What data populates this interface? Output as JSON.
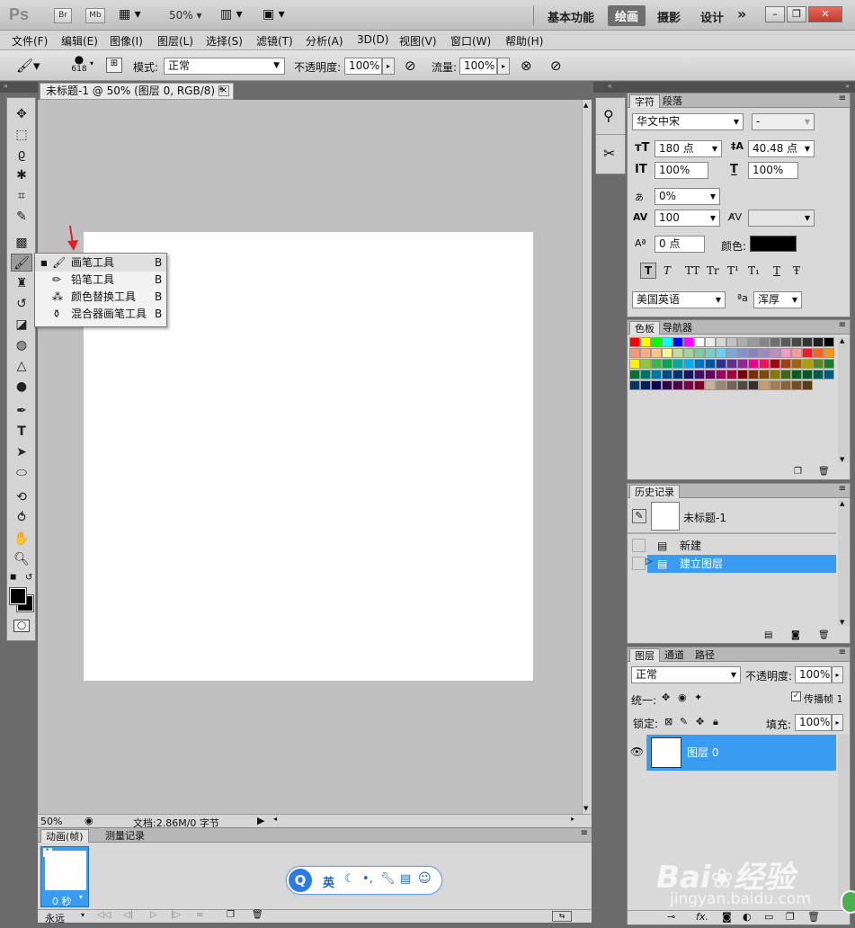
{
  "app": {
    "logo": "Ps",
    "bridge_label": "Br",
    "minibridge_label": "Mb",
    "zoom_select": "50%",
    "workspaces": [
      "基本功能",
      "绘画",
      "摄影",
      "设计"
    ],
    "active_workspace": "绘画",
    "more_glyph": "»"
  },
  "menubar": {
    "items": [
      "文件(F)",
      "编辑(E)",
      "图像(I)",
      "图层(L)",
      "选择(S)",
      "滤镜(T)",
      "分析(A)",
      "3D(D)",
      "视图(V)",
      "窗口(W)",
      "帮助(H)"
    ]
  },
  "options": {
    "brush_size": "618",
    "mode_label": "模式:",
    "mode_value": "正常",
    "opacity_label": "不透明度:",
    "opacity_value": "100%",
    "flow_label": "流量:",
    "flow_value": "100%"
  },
  "document": {
    "tab_title": "未标题-1 @ 50% (图层 0, RGB/8) *",
    "close_glyph": "×"
  },
  "status": {
    "zoom": "50%",
    "doc_info": "文档:2.86M/0 字节"
  },
  "tool_popup": {
    "items": [
      {
        "label": "画笔工具",
        "key": "B",
        "selected": true
      },
      {
        "label": "铅笔工具",
        "key": "B",
        "selected": false
      },
      {
        "label": "颜色替换工具",
        "key": "B",
        "selected": false
      },
      {
        "label": "混合器画笔工具",
        "key": "B",
        "selected": false
      }
    ]
  },
  "character_panel": {
    "tabs": [
      "字符",
      "段落"
    ],
    "font_family": "华文中宋",
    "font_style": "-",
    "font_size": "180 点",
    "leading": "40.48 点",
    "vertical_scale": "100%",
    "horizontal_scale": "100%",
    "tsume": "0%",
    "tracking": "100",
    "baseline_shift": "0 点",
    "color_label": "颜色:",
    "language": "美国英语",
    "antialias": "浑厚",
    "style_buttons": [
      "T",
      "T",
      "TT",
      "Tr",
      "T¹",
      "T₁",
      "T",
      "Ŧ"
    ]
  },
  "swatches_panel": {
    "tabs": [
      "色板",
      "导航器"
    ],
    "colors": [
      "#ff0000",
      "#ffff00",
      "#00ff00",
      "#00ffff",
      "#0000ff",
      "#ff00ff",
      "#ffffff",
      "#ebebeb",
      "#d6d6d6",
      "#c2c2c2",
      "#adadad",
      "#999999",
      "#858585",
      "#707070",
      "#5c5c5c",
      "#474747",
      "#333333",
      "#1f1f1f",
      "#000000",
      "#f7977a",
      "#f9ad81",
      "#fdc68a",
      "#fff79a",
      "#c4df9b",
      "#a3d39c",
      "#82ca9d",
      "#7bcdc8",
      "#6ecff6",
      "#7ea7d8",
      "#8493ca",
      "#8882be",
      "#a187be",
      "#bc8dbf",
      "#f49ac2",
      "#f6989d",
      "#ed1c24",
      "#f26522",
      "#f7941d",
      "#fff200",
      "#8dc63f",
      "#39b54a",
      "#00a651",
      "#00a99d",
      "#00aeef",
      "#0072bc",
      "#0054a6",
      "#2e3192",
      "#662d91",
      "#92278f",
      "#ec008c",
      "#ed145b",
      "#9e0b0f",
      "#a0410d",
      "#a36209",
      "#aba000",
      "#598527",
      "#1a7b30",
      "#007236",
      "#00746b",
      "#0076a3",
      "#004b80",
      "#003471",
      "#1b1464",
      "#440e62",
      "#630460",
      "#9e005d",
      "#9e0039",
      "#790000",
      "#7b2e00",
      "#7d4900",
      "#827b00",
      "#406618",
      "#005e20",
      "#005826",
      "#005952",
      "#005b7f",
      "#003663",
      "#002157",
      "#0d004c",
      "#32004b",
      "#4b0049",
      "#7b0046",
      "#7a0026",
      "#c7b299",
      "#998675",
      "#736357",
      "#534741",
      "#362f2d",
      "#c69c6d",
      "#a67c52",
      "#8c6239",
      "#754c24",
      "#603913"
    ]
  },
  "history_panel": {
    "tab": "历史记录",
    "snapshot": "未标题-1",
    "items": [
      "新建",
      "建立图层"
    ],
    "active_index": 1
  },
  "layers_panel": {
    "tabs": [
      "图层",
      "通道",
      "路径"
    ],
    "blend_mode": "正常",
    "opacity_label": "不透明度:",
    "opacity": "100%",
    "unify_label": "统一:",
    "propagate_label": "传播帧 1",
    "lock_label": "锁定:",
    "fill_label": "填充:",
    "fill": "100%",
    "layer_name": "图层 0"
  },
  "animation_panel": {
    "tabs": [
      "动画(帧)",
      "测量记录"
    ],
    "frame_number": "1",
    "frame_delay": "0 秒",
    "loop": "永远"
  },
  "ime_bar": {
    "lang": "英"
  },
  "watermark": {
    "brand": "Bai",
    "brand_suffix": "经验",
    "url": "jingyan.baidu.com"
  },
  "colors": {
    "selection_blue": "#3a9cf0",
    "red_arrow": "#e0202a"
  }
}
